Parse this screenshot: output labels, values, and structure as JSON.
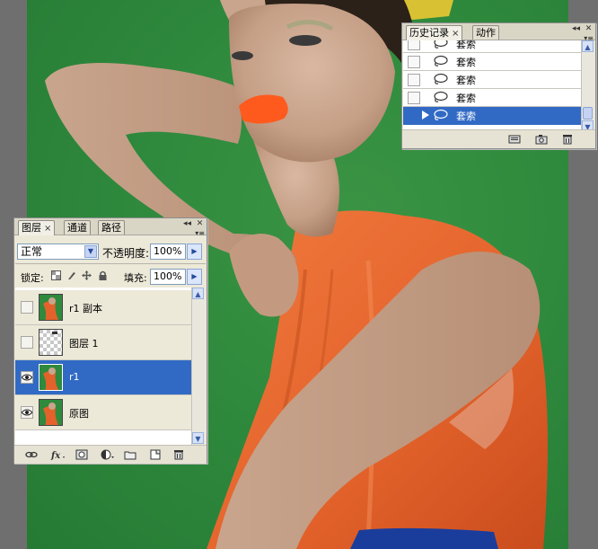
{
  "history_panel": {
    "tabs": [
      {
        "label": "历史记录",
        "close": "×",
        "active": true
      },
      {
        "label": "动作",
        "active": false
      }
    ],
    "items": [
      {
        "label": "套索",
        "icon": "lasso-icon",
        "selected": false
      },
      {
        "label": "套索",
        "icon": "lasso-icon",
        "selected": false
      },
      {
        "label": "套索",
        "icon": "lasso-icon",
        "selected": false
      },
      {
        "label": "套索",
        "icon": "lasso-icon",
        "selected": false
      },
      {
        "label": "套索",
        "icon": "lasso-icon",
        "selected": true
      }
    ],
    "footer_icons": [
      "new-document-from-state-icon",
      "camera-icon",
      "trash-icon"
    ]
  },
  "layers_panel": {
    "tabs": [
      {
        "label": "图层",
        "close": "×",
        "active": true
      },
      {
        "label": "通道",
        "active": false
      },
      {
        "label": "路径",
        "active": false
      }
    ],
    "blend_mode": "正常",
    "opacity_label": "不透明度:",
    "opacity_value": "100%",
    "lock_label": "锁定:",
    "fill_label": "填充:",
    "fill_value": "100%",
    "layers": [
      {
        "name": "r1 副本",
        "visible": false,
        "selected": false,
        "thumb": "photo"
      },
      {
        "name": "图层 1",
        "visible": false,
        "selected": false,
        "thumb": "transparent"
      },
      {
        "name": "r1",
        "visible": true,
        "selected": true,
        "thumb": "photo"
      },
      {
        "name": "原图",
        "visible": true,
        "selected": false,
        "thumb": "photo"
      }
    ],
    "footer_icons": [
      "link-icon",
      "fx-icon",
      "mask-icon",
      "adjustment-icon",
      "folder-icon",
      "new-layer-icon",
      "trash-icon"
    ]
  },
  "colors": {
    "background_green": "#2f8a3d",
    "selection_blue": "#316ac5",
    "panel_bg": "#ece9d8",
    "dress_orange": "#e8662e",
    "lips_orange": "#ff5a1e"
  }
}
